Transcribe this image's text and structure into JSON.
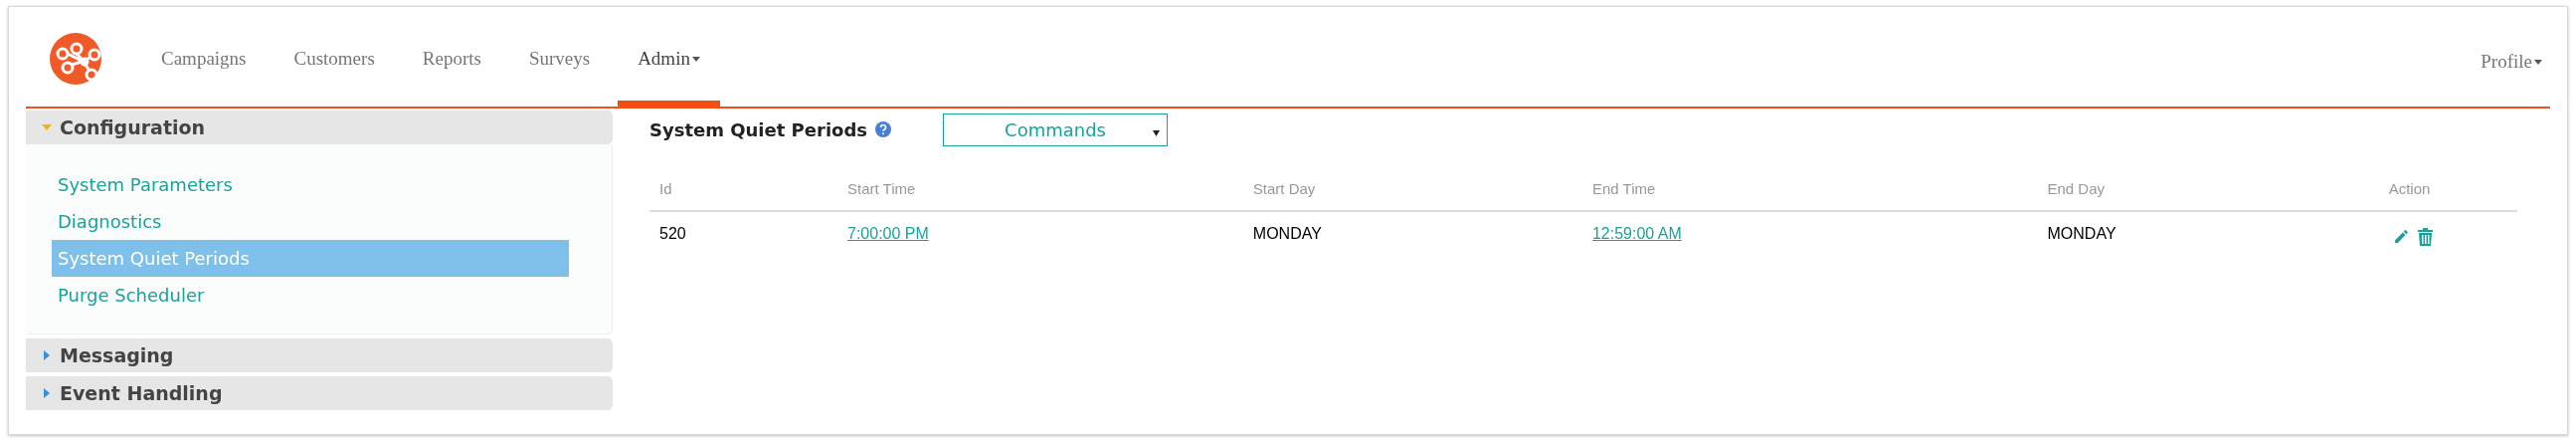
{
  "nav": {
    "items": [
      {
        "label": "Campaigns",
        "selected": false,
        "dropdown": false
      },
      {
        "label": "Customers",
        "selected": false,
        "dropdown": false
      },
      {
        "label": "Reports",
        "selected": false,
        "dropdown": false
      },
      {
        "label": "Surveys",
        "selected": false,
        "dropdown": false
      },
      {
        "label": "Admin",
        "selected": true,
        "dropdown": true
      }
    ],
    "profile": "Profile"
  },
  "sidebar": {
    "sections": [
      {
        "title": "Configuration",
        "expanded": true,
        "items": [
          {
            "label": "System Parameters",
            "selected": false
          },
          {
            "label": "Diagnostics",
            "selected": false
          },
          {
            "label": "System Quiet Periods",
            "selected": true
          },
          {
            "label": "Purge Scheduler",
            "selected": false
          }
        ]
      },
      {
        "title": "Messaging",
        "expanded": false
      },
      {
        "title": "Event Handling",
        "expanded": false
      }
    ]
  },
  "main": {
    "title": "System Quiet Periods",
    "commands": "Commands",
    "table": {
      "columns": [
        "Id",
        "Start Time",
        "Start Day",
        "End Time",
        "End Day",
        "Action"
      ],
      "rows": [
        {
          "cells": [
            {
              "text": "520",
              "kind": "text"
            },
            {
              "text": "7:00:00 PM",
              "kind": "link"
            },
            {
              "text": "MONDAY",
              "kind": "text"
            },
            {
              "text": "12:59:00 AM",
              "kind": "link"
            },
            {
              "text": "MONDAY",
              "kind": "text"
            }
          ]
        }
      ]
    }
  }
}
